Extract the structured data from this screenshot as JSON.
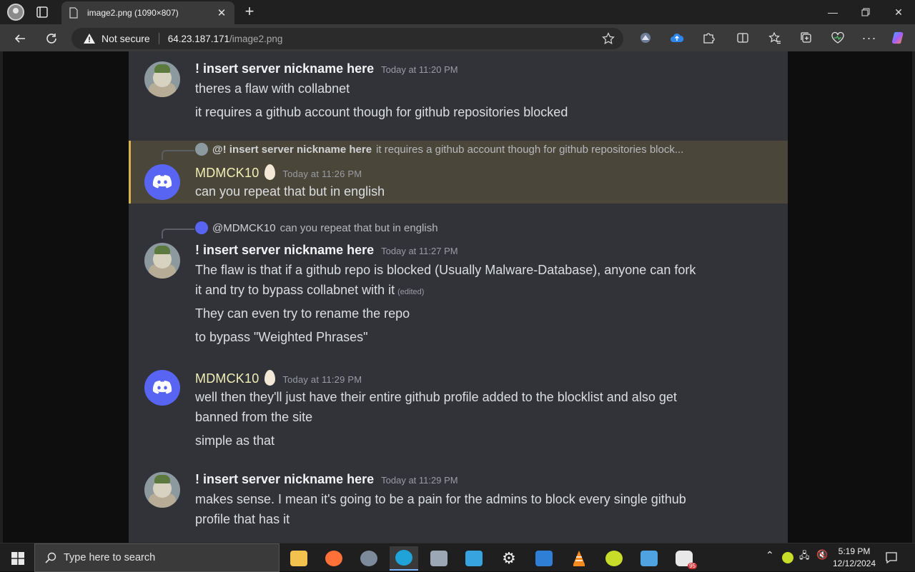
{
  "browser": {
    "tab_title": "image2.png (1090×807)",
    "security_label": "Not secure",
    "url_host": "64.23.187.171",
    "url_path": "/image2.png"
  },
  "chat": {
    "messages": [
      {
        "author": "! insert server nickname here",
        "timestamp": "Today at 11:20 PM",
        "lines": [
          "theres a flaw with collabnet",
          "it requires a github account though for github repositories blocked"
        ]
      },
      {
        "reply_to": {
          "author": "@! insert server nickname here",
          "text": "it requires a github account though for github repositories block..."
        },
        "author": "MDMCK10",
        "timestamp": "Today at 11:26 PM",
        "lines": [
          "can you repeat that but in english"
        ]
      },
      {
        "reply_to": {
          "author": "@MDMCK10",
          "text": "can you repeat that but in english"
        },
        "author": "! insert server nickname here",
        "timestamp": "Today at 11:27 PM",
        "lines": [
          "The flaw is that if a github repo is blocked (Usually Malware-Database), anyone can fork",
          "it and try to bypass collabnet with it",
          "They can even try to rename the repo",
          "to bypass \"Weighted Phrases\""
        ],
        "edited_label": "(edited)"
      },
      {
        "author": "MDMCK10",
        "timestamp": "Today at 11:29 PM",
        "lines": [
          "well then they'll just have their entire github profile added to the blocklist and also get",
          "banned from the site",
          "simple as that"
        ]
      },
      {
        "author": "! insert server nickname here",
        "timestamp": "Today at 11:29 PM",
        "lines": [
          "makes sense. I mean it's going to be a pain for the admins to block every single github",
          "profile that has it"
        ]
      }
    ]
  },
  "taskbar": {
    "search_placeholder": "Type here to search",
    "time": "5:19 PM",
    "date": "12/12/2024",
    "badge_count": "95"
  },
  "colors": {
    "highlight_border": "#d9b44a",
    "discord_blue": "#5865f2",
    "mdmck_name": "#f1f0b6"
  }
}
